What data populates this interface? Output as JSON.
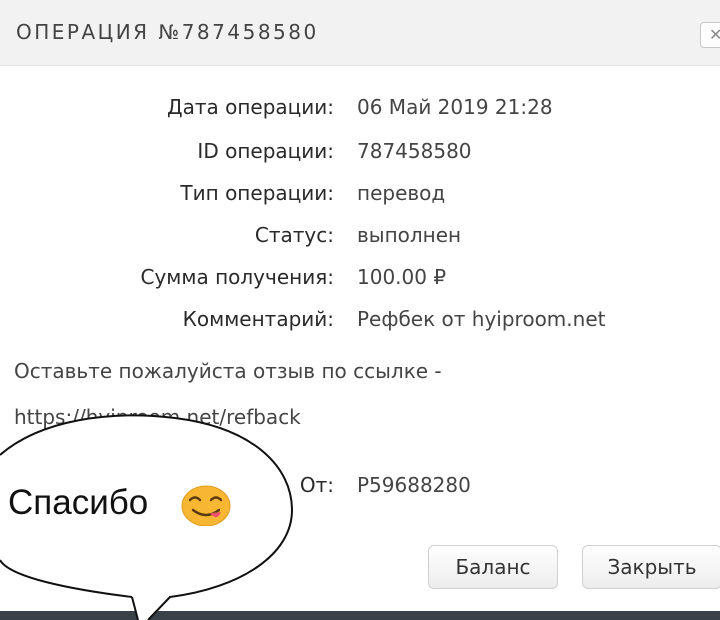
{
  "dialog": {
    "title": "ОПЕРАЦИЯ №787458580",
    "close_icon": "close-icon"
  },
  "details": [
    {
      "label": "Дата операции:",
      "value": "06 Май 2019 21:28"
    },
    {
      "label": "ID операции:",
      "value": "787458580"
    },
    {
      "label": "Тип операции:",
      "value": "перевод"
    },
    {
      "label": "Статус:",
      "value": "выполнен"
    },
    {
      "label": "Сумма получения:",
      "value": "100.00 ₽"
    },
    {
      "label": "Комментарий:",
      "value": "Рефбек от hyiproom.net"
    }
  ],
  "comment": {
    "line1": "Оставьте пожалуйста отзыв по ссылке -",
    "line2": "https://hyiproom.net/refback"
  },
  "from": {
    "label": "От:",
    "value": "P59688280"
  },
  "buttons": {
    "balance": "Баланс",
    "close": "Закрыть"
  },
  "speech_bubble": {
    "text": "Спасибо",
    "emoji": "yum-face-icon"
  },
  "colors": {
    "header_bg": "#f2f2f2",
    "footer_bg": "#3b4149",
    "emoji": "#f7b733"
  }
}
